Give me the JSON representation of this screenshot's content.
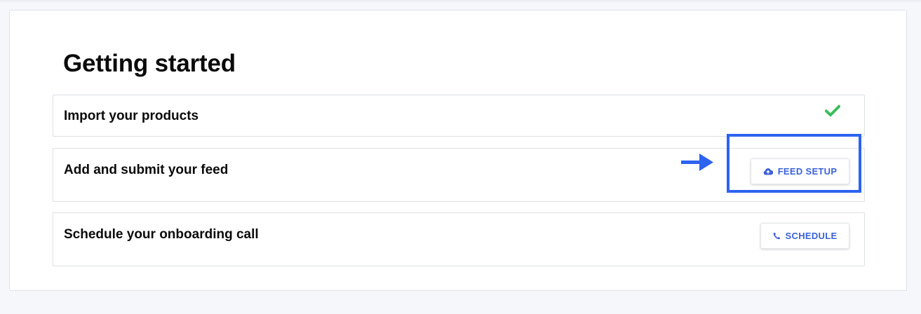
{
  "page": {
    "title": "Getting started"
  },
  "steps": [
    {
      "label": "Import your products",
      "status": "completed",
      "status_icon": "check-icon",
      "status_color": "#3dbd5d"
    },
    {
      "label": "Add and submit your feed",
      "action_label": "FEED SETUP",
      "action_icon": "cloud-upload-icon"
    },
    {
      "label": "Schedule your onboarding call",
      "action_label": "SCHEDULE",
      "action_icon": "phone-icon"
    }
  ],
  "annotations": {
    "highlight_color": "#2d63f0",
    "arrow_icon": "right-arrow-icon"
  },
  "colors": {
    "accent": "#3b62d8",
    "success": "#3dbd5d"
  }
}
